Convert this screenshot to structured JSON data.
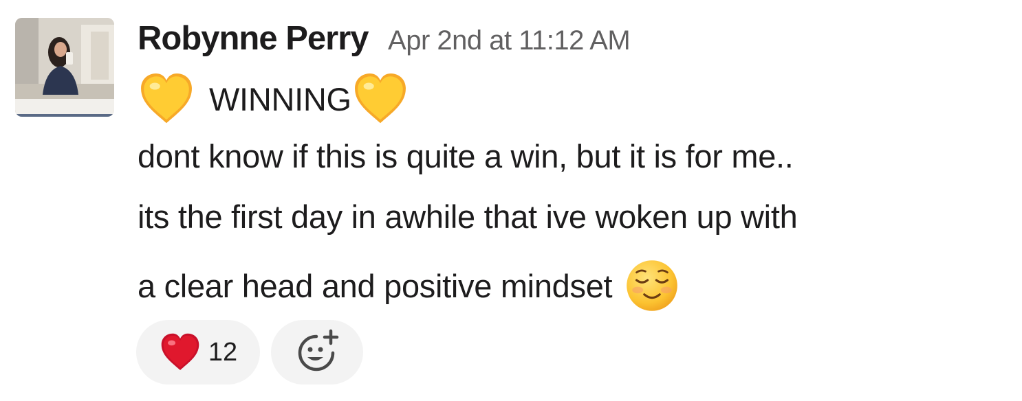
{
  "message": {
    "author": "Robynne Perry",
    "timestamp": "Apr 2nd at 11:12 AM",
    "lines": [
      "WINNING",
      "dont know if this is quite a win, but it is for me..",
      "its the first day in awhile that ive woken up with",
      "a clear head and positive mindset"
    ],
    "emoji": [
      "yellow-heart",
      "yellow-heart",
      "relaxed"
    ]
  },
  "reactions": [
    {
      "emoji": "red-heart",
      "count": "12"
    }
  ],
  "add_reaction_icon": "add-emoji-icon",
  "colors": {
    "text": "#1d1c1d",
    "muted": "#616061",
    "pill_bg": "#f3f3f3",
    "yellow_heart": "#ffcc33",
    "red_heart": "#e0182d"
  }
}
